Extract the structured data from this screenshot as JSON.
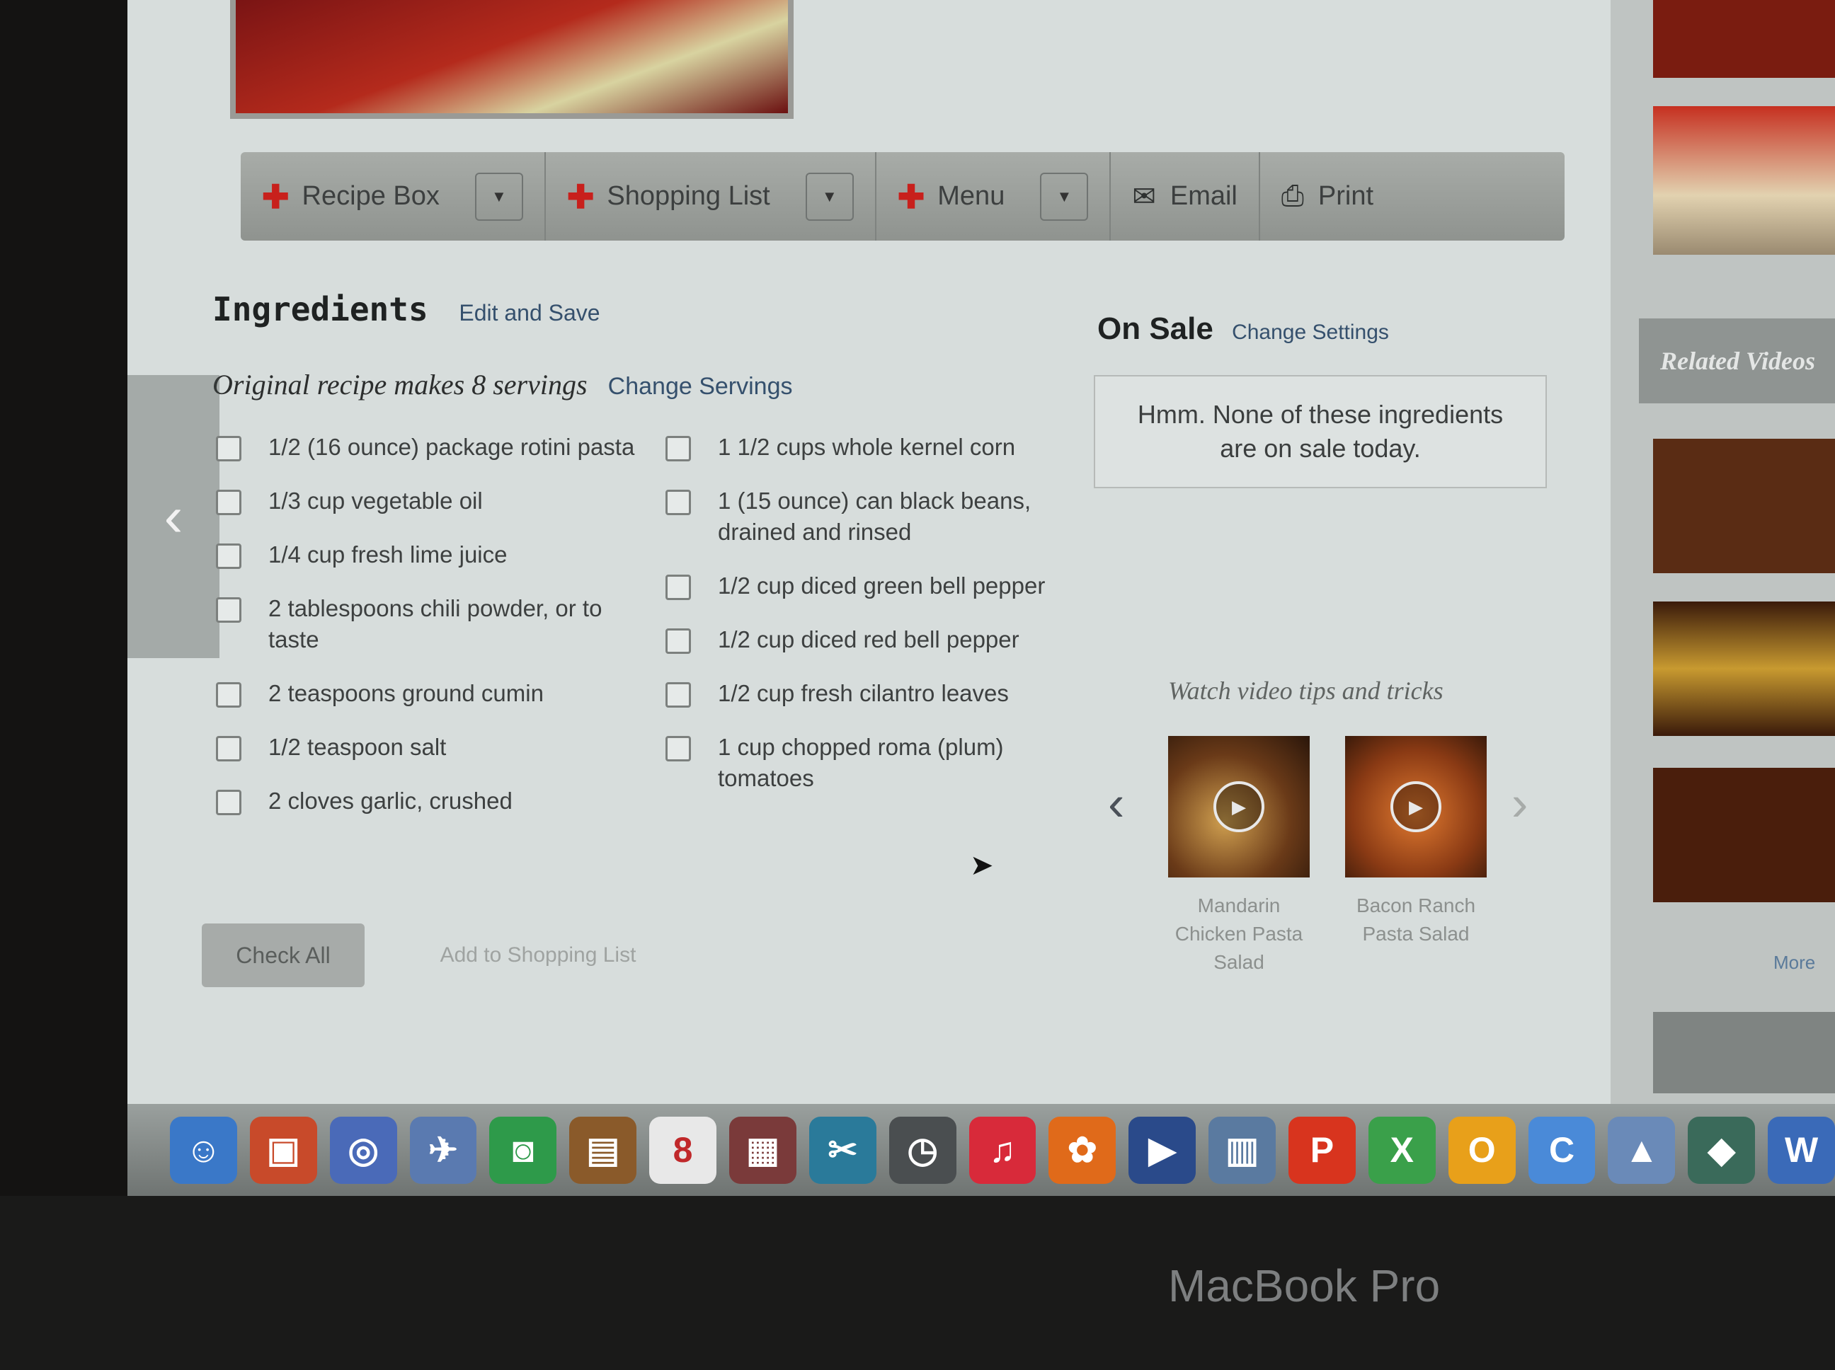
{
  "toolbar": {
    "recipe_box": "Recipe Box",
    "shopping_list": "Shopping List",
    "menu": "Menu",
    "email": "Email",
    "print": "Print",
    "plus": "✚",
    "dropdown": "▼",
    "email_icon": "envelope-icon",
    "print_icon": "printer-icon"
  },
  "ingredients": {
    "title": "Ingredients",
    "edit_link": "Edit and Save",
    "servings_text": "Original recipe makes 8 servings",
    "change_servings": "Change Servings",
    "left_column": [
      "1/2 (16 ounce) package rotini pasta",
      "1/3 cup vegetable oil",
      "1/4 cup fresh lime juice",
      "2 tablespoons chili powder, or to taste",
      "2 teaspoons ground cumin",
      "1/2 teaspoon salt",
      "2 cloves garlic, crushed"
    ],
    "right_column": [
      "1 1/2 cups whole kernel corn",
      "1 (15 ounce) can black beans, drained and rinsed",
      "1/2 cup diced green bell pepper",
      "1/2 cup diced red bell pepper",
      "1/2 cup fresh cilantro leaves",
      "1 cup chopped roma (plum) tomatoes"
    ],
    "check_all": "Check All",
    "add_to_shopping_list": "Add to Shopping List"
  },
  "on_sale": {
    "title": "On Sale",
    "change_settings": "Change Settings",
    "message": "Hmm. None of these ingredients are on sale today."
  },
  "video_tips": {
    "title": "Watch video tips and tricks",
    "videos": [
      {
        "title": "Mandarin Chicken Pasta Salad"
      },
      {
        "title": "Bacon Ranch Pasta Salad"
      }
    ]
  },
  "right_rail": {
    "related_videos": "Related Videos",
    "more": "More"
  },
  "dock": {
    "icons": [
      {
        "name": "finder-icon",
        "color": "#3a78c8",
        "glyph": "☺"
      },
      {
        "name": "photo-booth-icon",
        "color": "#c84a2a",
        "glyph": "▣"
      },
      {
        "name": "safari-icon",
        "color": "#4a6ab8",
        "glyph": "◎"
      },
      {
        "name": "mail-icon",
        "color": "#5a7ab0",
        "glyph": "✈"
      },
      {
        "name": "facetime-icon",
        "color": "#2e9a4a",
        "glyph": "◙"
      },
      {
        "name": "contacts-icon",
        "color": "#8a5a2a",
        "glyph": "▤"
      },
      {
        "name": "calendar-icon",
        "color": "#e8e8e8",
        "glyph": "8"
      },
      {
        "name": "photos-icon",
        "color": "#7a3a3a",
        "glyph": "▦"
      },
      {
        "name": "preview-icon",
        "color": "#2a7a9a",
        "glyph": "✂"
      },
      {
        "name": "time-machine-icon",
        "color": "#4a4e50",
        "glyph": "◷"
      },
      {
        "name": "itunes-icon",
        "color": "#d82a3a",
        "glyph": "♫"
      },
      {
        "name": "dashboard-icon",
        "color": "#e06a1a",
        "glyph": "✿"
      },
      {
        "name": "quicktime-icon",
        "color": "#2a4a8a",
        "glyph": "▶"
      },
      {
        "name": "finder-window-icon",
        "color": "#5a7aa0",
        "glyph": "▥"
      },
      {
        "name": "powerpoint-icon",
        "color": "#d8341e",
        "glyph": "P"
      },
      {
        "name": "excel-icon",
        "color": "#3aa04a",
        "glyph": "X"
      },
      {
        "name": "outlook-icon",
        "color": "#e8a01a",
        "glyph": "O"
      },
      {
        "name": "chrome-icon",
        "color": "#4a8ad8",
        "glyph": "C"
      },
      {
        "name": "downloads-icon",
        "color": "#6a8ab8",
        "glyph": "▲"
      },
      {
        "name": "stack-icon",
        "color": "#3a6a5a",
        "glyph": "◆"
      },
      {
        "name": "word-icon",
        "color": "#3a6ab8",
        "glyph": "W"
      }
    ]
  },
  "hardware": {
    "label": "MacBook Pro"
  }
}
